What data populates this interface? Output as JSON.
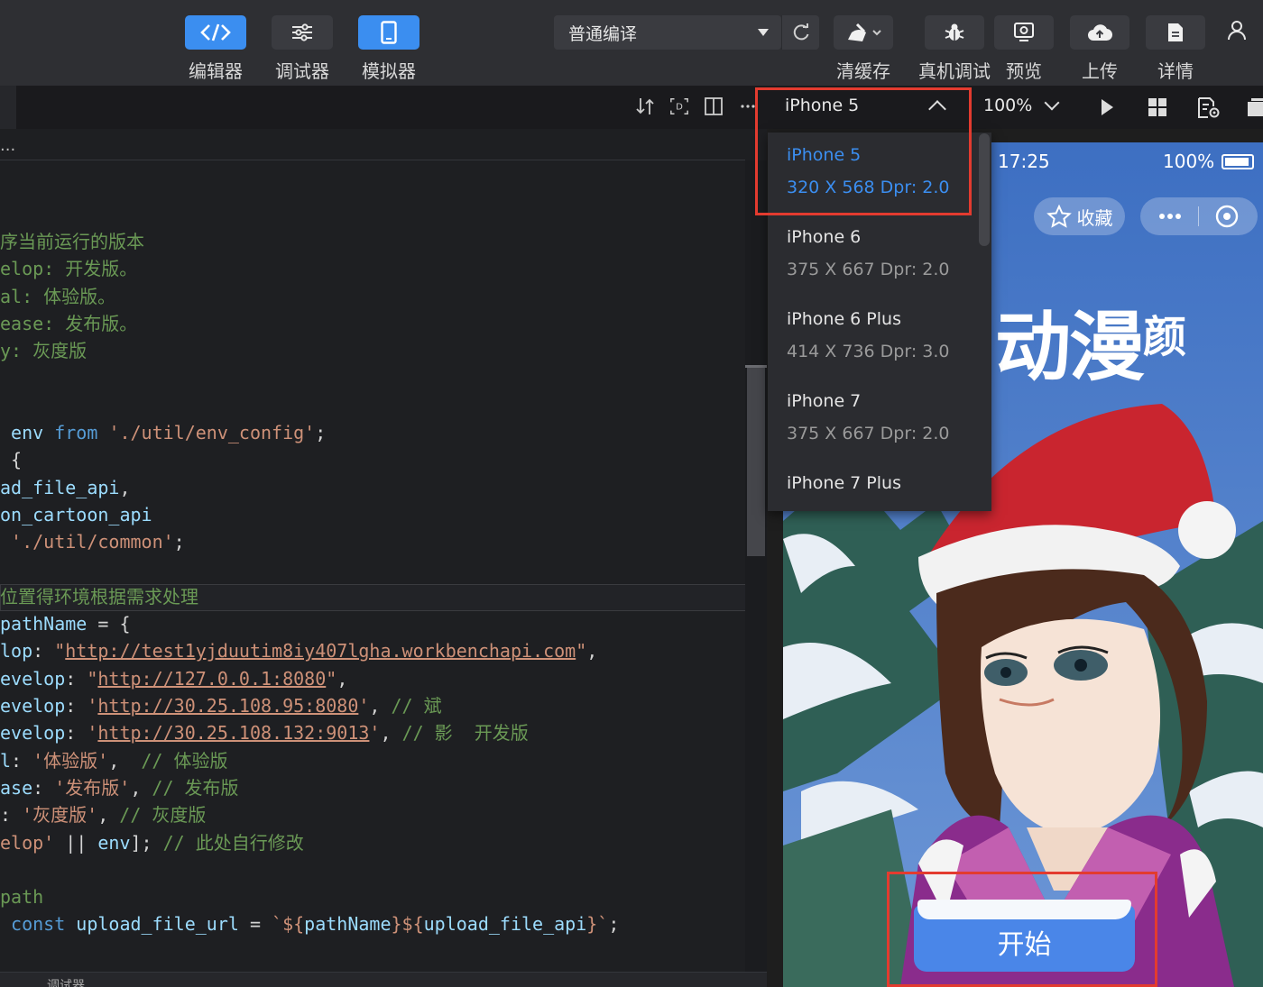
{
  "toolbar": {
    "editor_label": "编辑器",
    "debugger_label": "调试器",
    "simulator_label": "模拟器",
    "compile_mode": "普通编译",
    "clear_cache_label": "清缓存",
    "real_debug_label": "真机调试",
    "preview_label": "预览",
    "upload_label": "上传",
    "details_label": "详情"
  },
  "editor": {
    "tab_overflow": "...",
    "bottom_tab": "调试器",
    "lines": [
      {
        "segments": [
          {
            "t": "序当前运行的版本",
            "c": "cmt"
          }
        ]
      },
      {
        "segments": [
          {
            "t": "elop: 开发版。",
            "c": "cmt"
          }
        ]
      },
      {
        "segments": [
          {
            "t": "al: 体验版。",
            "c": "cmt"
          }
        ]
      },
      {
        "segments": [
          {
            "t": "ease: 发布版。",
            "c": "cmt"
          }
        ]
      },
      {
        "segments": [
          {
            "t": "y: 灰度版",
            "c": "cmt"
          }
        ]
      },
      {
        "segments": []
      },
      {
        "segments": []
      },
      {
        "segments": [
          {
            "t": " env ",
            "c": "var"
          },
          {
            "t": "from ",
            "c": "kw"
          },
          {
            "t": "'./util/env_config'",
            "c": "str"
          },
          {
            "t": ";",
            "c": "txt"
          }
        ]
      },
      {
        "segments": [
          {
            "t": " {",
            "c": "txt"
          }
        ]
      },
      {
        "segments": [
          {
            "t": "ad_file_api",
            "c": "var"
          },
          {
            "t": ",",
            "c": "txt"
          }
        ]
      },
      {
        "segments": [
          {
            "t": "on_cartoon_api",
            "c": "var"
          }
        ]
      },
      {
        "segments": [
          {
            "t": " ",
            "c": "txt"
          },
          {
            "t": "'./util/common'",
            "c": "str"
          },
          {
            "t": ";",
            "c": "txt"
          }
        ]
      },
      {
        "segments": []
      },
      {
        "segments": [
          {
            "t": "位置得环境根据需求处理",
            "c": "cmt"
          }
        ]
      },
      {
        "segments": [
          {
            "t": "pathName",
            "c": "var"
          },
          {
            "t": " = {",
            "c": "txt"
          }
        ]
      },
      {
        "segments": [
          {
            "t": "lop",
            "c": "var"
          },
          {
            "t": ": ",
            "c": "txt"
          },
          {
            "t": "\"",
            "c": "str"
          },
          {
            "t": "http://test1yjduutim8iy407lgha.workbenchapi.com",
            "c": "str",
            "u": true
          },
          {
            "t": "\"",
            "c": "str"
          },
          {
            "t": ",",
            "c": "txt"
          }
        ]
      },
      {
        "segments": [
          {
            "t": "evelop",
            "c": "var"
          },
          {
            "t": ": ",
            "c": "txt"
          },
          {
            "t": "\"",
            "c": "str"
          },
          {
            "t": "http://127.0.0.1:8080",
            "c": "str",
            "u": true
          },
          {
            "t": "\"",
            "c": "str"
          },
          {
            "t": ",",
            "c": "txt"
          }
        ]
      },
      {
        "segments": [
          {
            "t": "evelop",
            "c": "var"
          },
          {
            "t": ": ",
            "c": "txt"
          },
          {
            "t": "'",
            "c": "str"
          },
          {
            "t": "http://30.25.108.95:8080",
            "c": "str",
            "u": true
          },
          {
            "t": "'",
            "c": "str"
          },
          {
            "t": ", ",
            "c": "txt"
          },
          {
            "t": "// 斌",
            "c": "cmt"
          }
        ]
      },
      {
        "segments": [
          {
            "t": "evelop",
            "c": "var"
          },
          {
            "t": ": ",
            "c": "txt"
          },
          {
            "t": "'",
            "c": "str"
          },
          {
            "t": "http://30.25.108.132:9013",
            "c": "str",
            "u": true
          },
          {
            "t": "'",
            "c": "str"
          },
          {
            "t": ", ",
            "c": "txt"
          },
          {
            "t": "// 影  开发版",
            "c": "cmt"
          }
        ]
      },
      {
        "segments": [
          {
            "t": "l",
            "c": "var"
          },
          {
            "t": ": ",
            "c": "txt"
          },
          {
            "t": "'体验版'",
            "c": "str"
          },
          {
            "t": ",  ",
            "c": "txt"
          },
          {
            "t": "// 体验版",
            "c": "cmt"
          }
        ]
      },
      {
        "segments": [
          {
            "t": "ase",
            "c": "var"
          },
          {
            "t": ": ",
            "c": "txt"
          },
          {
            "t": "'发布版'",
            "c": "str"
          },
          {
            "t": ", ",
            "c": "txt"
          },
          {
            "t": "// 发布版",
            "c": "cmt"
          }
        ]
      },
      {
        "segments": [
          {
            "t": ": ",
            "c": "txt"
          },
          {
            "t": "'灰度版'",
            "c": "str"
          },
          {
            "t": ", ",
            "c": "txt"
          },
          {
            "t": "// 灰度版",
            "c": "cmt"
          }
        ]
      },
      {
        "segments": [
          {
            "t": "elop'",
            "c": "str"
          },
          {
            "t": " || ",
            "c": "txt"
          },
          {
            "t": "env",
            "c": "var"
          },
          {
            "t": "]; ",
            "c": "txt"
          },
          {
            "t": "// 此处自行修改",
            "c": "cmt"
          }
        ]
      },
      {
        "segments": []
      },
      {
        "segments": [
          {
            "t": "path",
            "c": "cmt"
          }
        ]
      },
      {
        "segments": [
          {
            "t": " const ",
            "c": "kw"
          },
          {
            "t": "upload_file_url",
            "c": "var"
          },
          {
            "t": " = ",
            "c": "txt"
          },
          {
            "t": "`${",
            "c": "str"
          },
          {
            "t": "pathName",
            "c": "var"
          },
          {
            "t": "}${",
            "c": "str"
          },
          {
            "t": "upload_file_api",
            "c": "var"
          },
          {
            "t": "}`",
            "c": "str"
          },
          {
            "t": ";",
            "c": "txt"
          }
        ]
      }
    ]
  },
  "simulator": {
    "device": "iPhone 5",
    "zoom": "100%",
    "devices": [
      {
        "name": "iPhone 5",
        "spec": "320 X 568 Dpr: 2.0",
        "selected": true
      },
      {
        "name": "iPhone 6",
        "spec": "375 X 667 Dpr: 2.0",
        "selected": false
      },
      {
        "name": "iPhone 6 Plus",
        "spec": "414 X 736 Dpr: 3.0",
        "selected": false
      },
      {
        "name": "iPhone 7",
        "spec": "375 X 667 Dpr: 2.0",
        "selected": false
      },
      {
        "name": "iPhone 7 Plus",
        "spec": "",
        "selected": false
      }
    ]
  },
  "phone": {
    "time": "17:25",
    "battery": "100%",
    "favorite_label": "收藏",
    "title_main": "动漫",
    "title_small": "颜",
    "start_label": "开始"
  },
  "colors": {
    "accent": "#3b8ef0",
    "highlight_red": "#e33b2f",
    "start_button": "#4a86e8"
  }
}
